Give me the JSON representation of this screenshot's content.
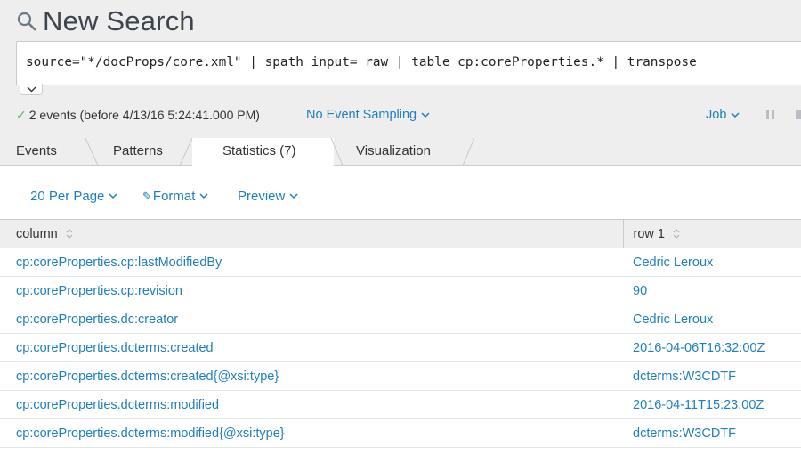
{
  "header": {
    "title": "New Search"
  },
  "search": {
    "query": "source=\"*/docProps/core.xml\" | spath input=_raw | table cp:coreProperties.* | transpose"
  },
  "status": {
    "events_text": "2 events (before 4/13/16 5:24:41.000 PM)",
    "sampling_label": "No Event Sampling",
    "job_label": "Job"
  },
  "tabs": [
    {
      "label": "Events"
    },
    {
      "label": "Patterns"
    },
    {
      "label": "Statistics (7)",
      "active": true
    },
    {
      "label": "Visualization"
    }
  ],
  "toolbar": {
    "per_page": "20 Per Page",
    "format": "Format",
    "preview": "Preview"
  },
  "table": {
    "columns": [
      "column",
      "row 1"
    ],
    "rows": [
      [
        "cp:coreProperties.cp:lastModifiedBy",
        "Cedric Leroux"
      ],
      [
        "cp:coreProperties.cp:revision",
        "90"
      ],
      [
        "cp:coreProperties.dc:creator",
        "Cedric Leroux"
      ],
      [
        "cp:coreProperties.dcterms:created",
        "2016-04-06T16:32:00Z"
      ],
      [
        "cp:coreProperties.dcterms:created{@xsi:type}",
        "dcterms:W3CDTF"
      ],
      [
        "cp:coreProperties.dcterms:modified",
        "2016-04-11T15:23:00Z"
      ],
      [
        "cp:coreProperties.dcterms:modified{@xsi:type}",
        "dcterms:W3CDTF"
      ]
    ]
  },
  "colors": {
    "link": "#1e7fc0",
    "success": "#5cc05c",
    "background": "#eeeeee"
  }
}
